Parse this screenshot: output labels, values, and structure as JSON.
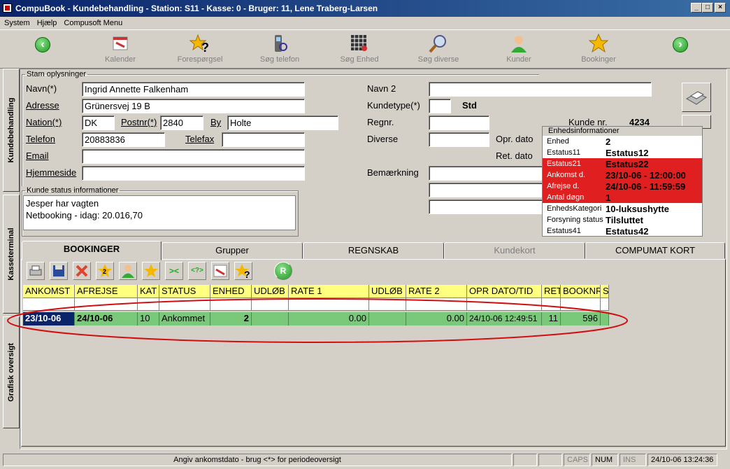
{
  "window": {
    "title": "CompuBook - Kundebehandling - Station: S11 - Kasse: 0 - Bruger: 11, Lene Traberg-Larsen"
  },
  "menu": [
    "System",
    "Hjælp",
    "Compusoft Menu"
  ],
  "toolbar": [
    {
      "label": "Kalender",
      "icon": "calendar-icon"
    },
    {
      "label": "Forespørgsel",
      "icon": "star-question-icon"
    },
    {
      "label": "Søg telefon",
      "icon": "phone-search-icon"
    },
    {
      "label": "Søg Enhed",
      "icon": "grid-search-icon"
    },
    {
      "label": "Søg diverse",
      "icon": "magnifier-icon"
    },
    {
      "label": "Kunder",
      "icon": "person-icon"
    },
    {
      "label": "Bookinger",
      "icon": "star-icon"
    }
  ],
  "side_tabs": [
    "Kundebehandling",
    "Kasseterminal",
    "Grafisk oversigt"
  ],
  "stam": {
    "legend": "Stam oplysninger",
    "labels": {
      "navn": "Navn(*)",
      "adresse": "Adresse",
      "nation": "Nation(*)",
      "postnr": "Postnr(*)",
      "by": "By",
      "telefon": "Telefon",
      "telefax": "Telefax",
      "email": "Email",
      "hjemmeside": "Hjemmeside",
      "navn2": "Navn 2",
      "kundetype": "Kundetype(*)",
      "regnr": "Regnr.",
      "diverse": "Diverse",
      "oprdato": "Opr. dato",
      "retdato": "Ret. dato",
      "bemaerkning": "Bemærkning",
      "kundenr": "Kunde nr."
    },
    "values": {
      "navn": "Ingrid Annette Falkenham",
      "adresse": "Grünersvej 19 B",
      "nation": "DK",
      "postnr": "2840",
      "by": "Holte",
      "telefon": "20883836",
      "telefax": "",
      "email": "",
      "hjemmeside": "",
      "navn2": "",
      "kundetype": "",
      "kundetype_text": "Std",
      "regnr": "",
      "diverse": "",
      "kundenr": "4234"
    }
  },
  "status": {
    "legend": "Kunde status informationer",
    "lines": [
      "Jesper har vagten",
      "Netbooking - idag: 20.016,70"
    ]
  },
  "enhed": {
    "header": "Enhedsinformationer",
    "rows": [
      {
        "k": "Enhed",
        "v": "2",
        "red": false
      },
      {
        "k": "Estatus11",
        "v": "Estatus12",
        "red": false
      },
      {
        "k": "Estatus21",
        "v": "Estatus22",
        "red": true
      },
      {
        "k": "Ankomst d.",
        "v": "23/10-06 - 12:00:00",
        "red": true
      },
      {
        "k": "Afrejse d.",
        "v": "24/10-06 - 11:59:59",
        "red": true
      },
      {
        "k": "Antal døgn",
        "v": "1",
        "red": true
      },
      {
        "k": "EnhedsKategori",
        "v": "10-luksushytte",
        "red": false
      },
      {
        "k": "Forsyning status",
        "v": "Tilsluttet",
        "red": false
      },
      {
        "k": "Estatus41",
        "v": "Estatus42",
        "red": false
      }
    ]
  },
  "tabs": [
    {
      "label": "BOOKINGER"
    },
    {
      "label": "Grupper"
    },
    {
      "label": "REGNSKAB"
    },
    {
      "label": "Kundekort"
    },
    {
      "label": "COMPUMAT KORT"
    }
  ],
  "grid": {
    "headers": [
      "ANKOMST",
      "AFREJSE",
      "KAT",
      "STATUS",
      "ENHED",
      "UDLØB",
      "RATE 1",
      "UDLØB",
      "RATE 2",
      "OPR DATO/TID",
      "RET",
      "BOOKNR",
      "S"
    ],
    "row": [
      "23/10-06",
      "24/10-06",
      "10",
      "Ankommet",
      "2",
      "",
      "0.00",
      "",
      "0.00",
      "24/10-06 12:49:51",
      "11",
      "596",
      ""
    ]
  },
  "statusbar": {
    "message": "Angiv ankomstdato - brug <*> for periodeoversigt",
    "caps": "CAPS",
    "num": "NUM",
    "ins": "INS",
    "datetime": "24/10-06 13:24:36"
  },
  "colors": {
    "titlebar": "#0a246a",
    "header_yellow": "#ffff80",
    "row_green": "#7ac97a",
    "alert_red": "#e02020"
  }
}
